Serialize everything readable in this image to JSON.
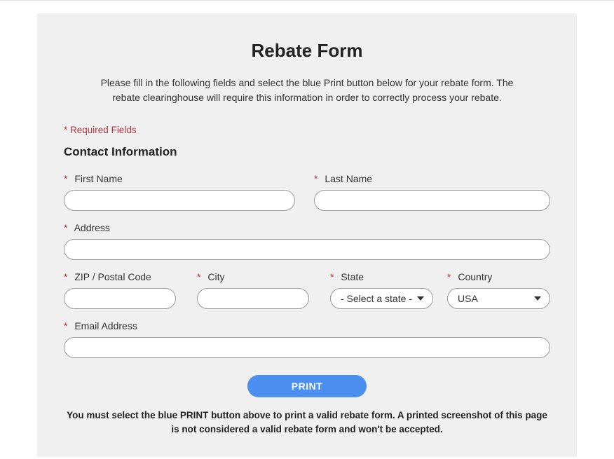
{
  "title": "Rebate Form",
  "intro": "Please fill in the following fields and select the blue Print button below for your rebate form. The rebate clearinghouse will require this information in order to correctly process your rebate.",
  "required_label": "Required Fields",
  "section_title": "Contact Information",
  "fields": {
    "first_name": {
      "label": "First Name",
      "value": ""
    },
    "last_name": {
      "label": "Last Name",
      "value": ""
    },
    "address": {
      "label": "Address",
      "value": ""
    },
    "zip": {
      "label": "ZIP / Postal Code",
      "value": ""
    },
    "city": {
      "label": "City",
      "value": ""
    },
    "state": {
      "label": "State",
      "placeholder": "- Select a state -",
      "value": ""
    },
    "country": {
      "label": "Country",
      "value": "USA"
    },
    "email": {
      "label": "Email Address",
      "value": ""
    }
  },
  "print_button": "PRINT",
  "footer_note": "You must select the blue PRINT button above to print a valid rebate form. A printed screenshot of this page is not considered a valid rebate form and won't be accepted."
}
